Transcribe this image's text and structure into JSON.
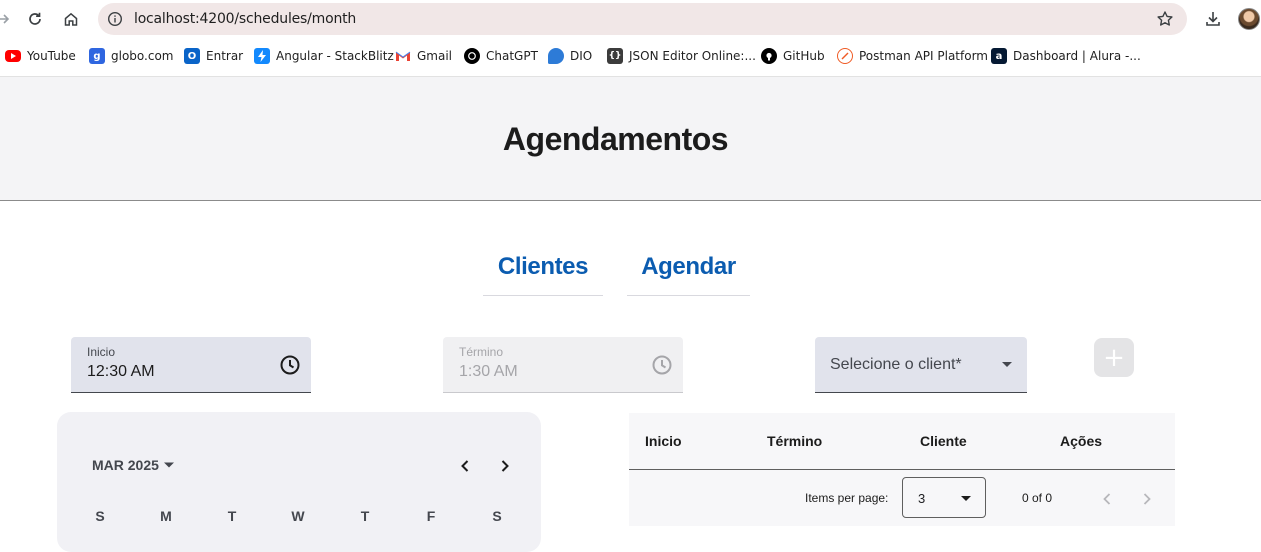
{
  "browser": {
    "url": "localhost:4200/schedules/month",
    "bookmarks": [
      {
        "label": "YouTube",
        "icon": "youtube-icon",
        "color": "#ff0000"
      },
      {
        "label": "globo.com",
        "icon": "globo-icon",
        "color": "#2f66e0"
      },
      {
        "label": "Entrar",
        "icon": "outlook-icon",
        "color": "#0a64c8"
      },
      {
        "label": "Angular - StackBlitz",
        "icon": "stackblitz-icon",
        "color": "#1389fd"
      },
      {
        "label": "Gmail",
        "icon": "gmail-icon",
        "color": "#ea4335"
      },
      {
        "label": "ChatGPT",
        "icon": "chatgpt-icon",
        "color": "#000000"
      },
      {
        "label": "DIO",
        "icon": "dio-icon",
        "color": "#2d7bd7"
      },
      {
        "label": "JSON Editor Online:...",
        "icon": "json-editor-icon",
        "color": "#3c3c3c"
      },
      {
        "label": "GitHub",
        "icon": "github-icon",
        "color": "#000000"
      },
      {
        "label": "Postman API Platform",
        "icon": "postman-icon",
        "color": "#ef5b25"
      },
      {
        "label": "Dashboard | Alura -...",
        "icon": "alura-icon",
        "color": "#051933"
      }
    ]
  },
  "page": {
    "title": "Agendamentos",
    "nav": [
      {
        "label": "Clientes"
      },
      {
        "label": "Agendar"
      }
    ]
  },
  "form": {
    "start": {
      "label": "Inicio",
      "value": "12:30 AM"
    },
    "end": {
      "label": "Término",
      "value": "1:30 AM"
    },
    "client_select": {
      "placeholder": "Selecione o client*"
    },
    "add_button_symbol": "+"
  },
  "calendar": {
    "month_label": "MAR 2025",
    "weekdays": [
      "S",
      "M",
      "T",
      "W",
      "T",
      "F",
      "S"
    ]
  },
  "table": {
    "columns": [
      "Inicio",
      "Término",
      "Cliente",
      "Ações"
    ],
    "paginator": {
      "items_per_page_label": "Items per page:",
      "page_size": "3",
      "range_label": "0 of 0"
    }
  },
  "colors": {
    "accent": "#0b5cb0",
    "header_bg": "#f4f4f6",
    "field_bg": "#e1e3ec",
    "field_disabled_bg": "#f0f0f2"
  }
}
